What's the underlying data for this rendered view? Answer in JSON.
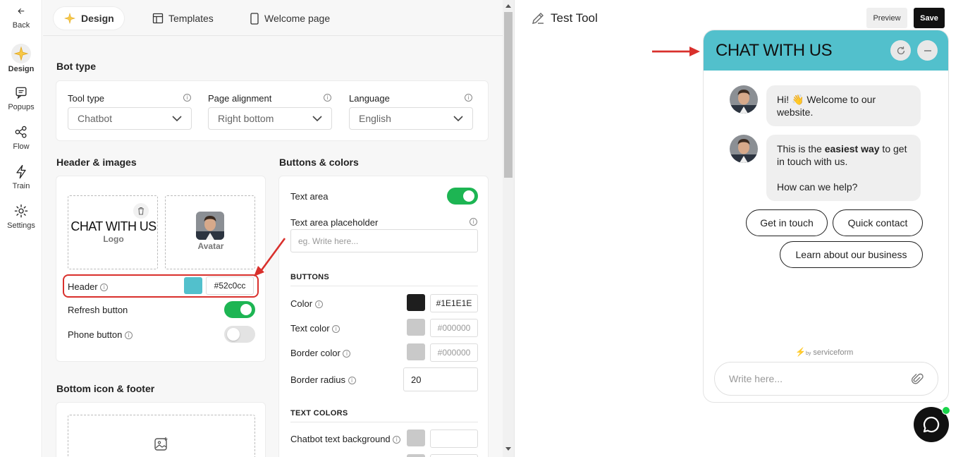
{
  "rail": {
    "back": "Back",
    "items": [
      {
        "label": "Design",
        "icon": "sparkle-icon"
      },
      {
        "label": "Popups",
        "icon": "chat-bubble-icon"
      },
      {
        "label": "Flow",
        "icon": "share-nodes-icon"
      },
      {
        "label": "Train",
        "icon": "lightning-icon"
      },
      {
        "label": "Settings",
        "icon": "gear-icon"
      }
    ]
  },
  "tabs": [
    {
      "label": "Design",
      "active": true
    },
    {
      "label": "Templates",
      "active": false
    },
    {
      "label": "Welcome page",
      "active": false
    }
  ],
  "bot_type": {
    "title": "Bot type",
    "tool_type": {
      "label": "Tool type",
      "value": "Chatbot"
    },
    "page_alignment": {
      "label": "Page alignment",
      "value": "Right bottom"
    },
    "language": {
      "label": "Language",
      "value": "English"
    }
  },
  "header_images": {
    "title": "Header & images",
    "logo_text": "CHAT WITH US",
    "logo_caption": "Logo",
    "avatar_caption": "Avatar",
    "header_label": "Header",
    "header_color": "#52c0cc",
    "refresh_label": "Refresh button",
    "refresh_on": true,
    "phone_label": "Phone button",
    "phone_on": false
  },
  "buttons_colors": {
    "title": "Buttons & colors",
    "text_area_label": "Text area",
    "text_area_on": true,
    "placeholder_label": "Text area placeholder",
    "placeholder_value": "eg. Write here...",
    "buttons_heading": "BUTTONS",
    "color_label": "Color",
    "color_value": "#1E1E1E",
    "text_color_label": "Text color",
    "text_color_value": "#000000",
    "border_color_label": "Border color",
    "border_color_value": "#000000",
    "border_radius_label": "Border radius",
    "border_radius_value": "20",
    "text_colors_heading": "TEXT COLORS",
    "chatbot_bg_label": "Chatbot text background"
  },
  "bottom": {
    "title": "Bottom icon & footer"
  },
  "preview": {
    "tool_name": "Test Tool",
    "preview_label": "Preview",
    "save_label": "Save",
    "widget_title": "CHAT WITH US",
    "msg1": "Hi! 👋 Welcome to our website.",
    "msg2_pre": "This is the ",
    "msg2_bold": "easiest way",
    "msg2_post": " to get in touch with us.",
    "msg2_line2": "How can we help?",
    "quick_replies": [
      "Get in touch",
      "Quick contact",
      "Learn about our business"
    ],
    "powered_by": "by",
    "brand": "serviceform",
    "compose_placeholder": "Write here..."
  },
  "colors": {
    "accent": "#52c0cc",
    "toggle_on": "#1db553",
    "annotation": "#d9302c"
  }
}
